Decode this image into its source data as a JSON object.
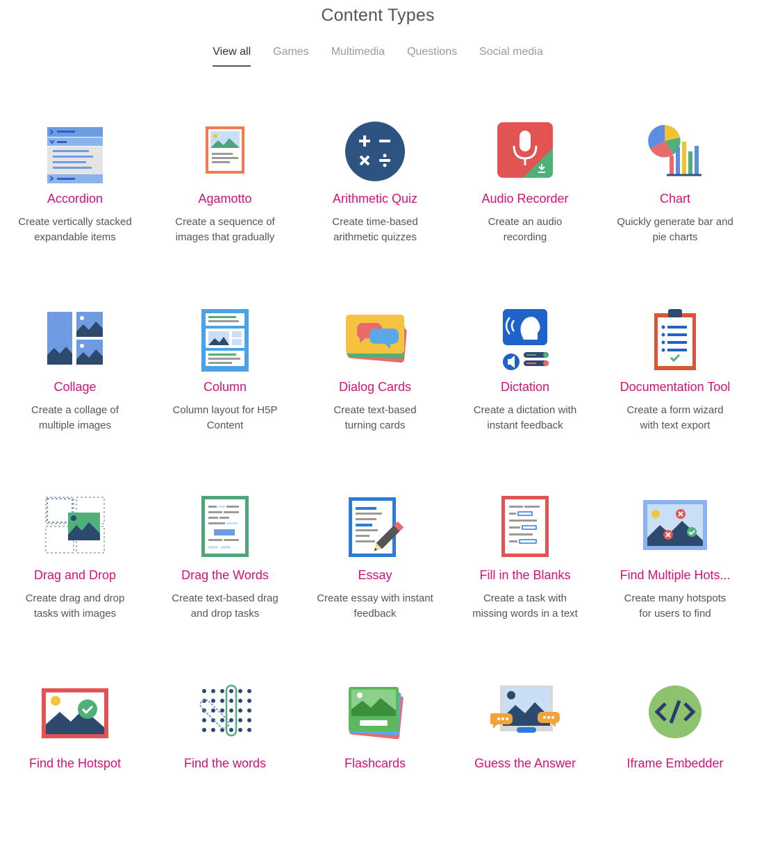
{
  "header": {
    "title": "Content Types"
  },
  "tabs": [
    {
      "label": "View all",
      "active": true
    },
    {
      "label": "Games"
    },
    {
      "label": "Multimedia"
    },
    {
      "label": "Questions"
    },
    {
      "label": "Social media"
    }
  ],
  "colors": {
    "title": "#d2127a",
    "accent_blue": "#3e6fd1",
    "active_tab_underline": "#555555"
  },
  "items": [
    {
      "title": "Accordion",
      "desc": "Create vertically stacked expandable items",
      "icon": "accordion-icon"
    },
    {
      "title": "Agamotto",
      "desc": "Create a sequence of images that gradually",
      "icon": "agamotto-icon"
    },
    {
      "title": "Arithmetic Quiz",
      "desc": "Create time-based arithmetic quizzes",
      "icon": "arithmetic-quiz-icon"
    },
    {
      "title": "Audio Recorder",
      "desc": "Create an audio recording",
      "icon": "audio-recorder-icon"
    },
    {
      "title": "Chart",
      "desc": "Quickly generate bar and pie charts",
      "icon": "chart-icon"
    },
    {
      "title": "Collage",
      "desc": "Create a collage of multiple images",
      "icon": "collage-icon"
    },
    {
      "title": "Column",
      "desc": "Column layout for H5P Content",
      "icon": "column-icon"
    },
    {
      "title": "Dialog Cards",
      "desc": "Create text-based turning cards",
      "icon": "dialog-cards-icon"
    },
    {
      "title": "Dictation",
      "desc": "Create a dictation with instant feedback",
      "icon": "dictation-icon"
    },
    {
      "title": "Documentation Tool",
      "desc": "Create a form wizard with text export",
      "icon": "documentation-tool-icon"
    },
    {
      "title": "Drag and Drop",
      "desc": "Create drag and drop tasks with images",
      "icon": "drag-and-drop-icon"
    },
    {
      "title": "Drag the Words",
      "desc": "Create text-based drag and drop tasks",
      "icon": "drag-the-words-icon"
    },
    {
      "title": "Essay",
      "desc": "Create essay with instant feedback",
      "icon": "essay-icon"
    },
    {
      "title": "Fill in the Blanks",
      "desc": "Create a task with missing words in a text",
      "icon": "fill-in-the-blanks-icon"
    },
    {
      "title": "Find Multiple Hots...",
      "desc": "Create many hotspots for users to find",
      "icon": "find-multiple-hotspots-icon"
    },
    {
      "title": "Find the Hotspot",
      "desc": "",
      "icon": "find-the-hotspot-icon"
    },
    {
      "title": "Find the words",
      "desc": "",
      "icon": "find-the-words-icon"
    },
    {
      "title": "Flashcards",
      "desc": "",
      "icon": "flashcards-icon"
    },
    {
      "title": "Guess the Answer",
      "desc": "",
      "icon": "guess-the-answer-icon"
    },
    {
      "title": "Iframe Embedder",
      "desc": "",
      "icon": "iframe-embedder-icon"
    }
  ]
}
